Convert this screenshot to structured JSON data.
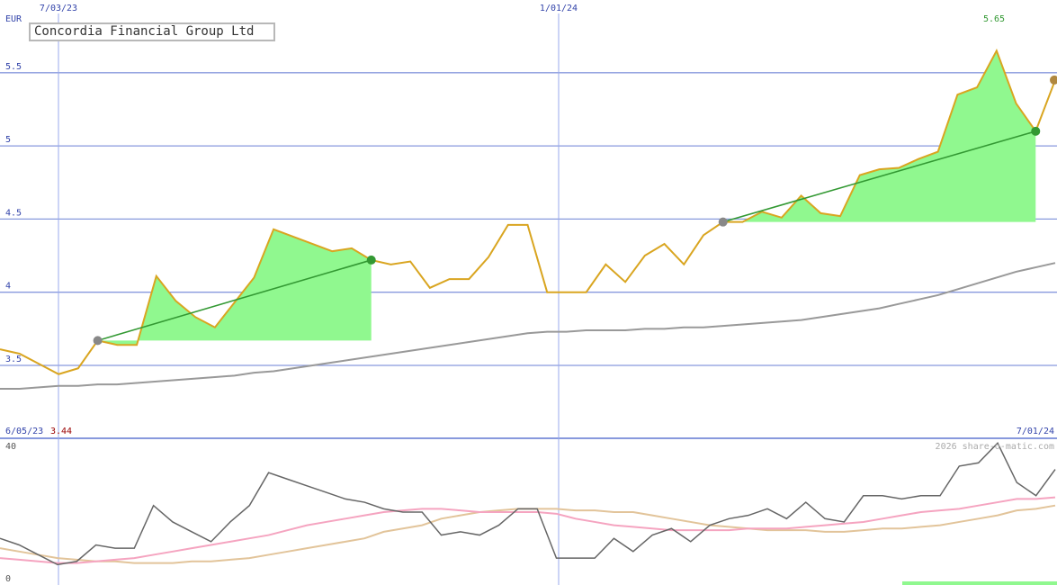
{
  "chart_data": [
    {
      "type": "line",
      "title": "Concordia Financial Group Ltd",
      "ylabel": "EUR",
      "ylim": [
        3.25,
        5.7
      ],
      "y_ticks": [
        "3.5",
        "4",
        "4.5",
        "5",
        "5.5"
      ],
      "x_tick_labels": [
        "7/03/23",
        "1/01/24"
      ],
      "start_date_label": "6/05/23",
      "end_date_label": "7/01/24",
      "low_label": "3.44",
      "high_label": "5.65",
      "grid": true,
      "series": [
        {
          "values": [
            3.61,
            3.58,
            3.51,
            3.44,
            3.48,
            3.67,
            3.64,
            3.64,
            4.11,
            3.94,
            3.83,
            3.76,
            3.93,
            4.1,
            4.43,
            4.38,
            4.33,
            4.28,
            4.3,
            4.22,
            4.19,
            4.21,
            4.03,
            4.09,
            4.09,
            4.24,
            4.46,
            4.46,
            4.0,
            4.0,
            4.0,
            4.19,
            4.07,
            4.25,
            4.33,
            4.19,
            4.39,
            4.48,
            4.48,
            4.55,
            4.51,
            4.66,
            4.54,
            4.52,
            4.8,
            4.84,
            4.85,
            4.91,
            4.96,
            5.35,
            5.4,
            5.65,
            5.29,
            5.1,
            5.45
          ]
        },
        {
          "values": [
            3.34,
            3.34,
            3.35,
            3.36,
            3.36,
            3.37,
            3.37,
            3.38,
            3.39,
            3.4,
            3.41,
            3.42,
            3.43,
            3.45,
            3.46,
            3.48,
            3.5,
            3.52,
            3.54,
            3.56,
            3.58,
            3.6,
            3.62,
            3.64,
            3.66,
            3.68,
            3.7,
            3.72,
            3.73,
            3.73,
            3.74,
            3.74,
            3.74,
            3.75,
            3.75,
            3.76,
            3.76,
            3.77,
            3.78,
            3.79,
            3.8,
            3.81,
            3.83,
            3.85,
            3.87,
            3.89,
            3.92,
            3.95,
            3.98,
            4.02,
            4.06,
            4.1,
            4.14,
            4.17,
            4.2
          ]
        }
      ],
      "trend_segments": [
        {
          "from_index": 5,
          "to_index": 19
        },
        {
          "from_index": 37,
          "to_index": 53
        }
      ]
    },
    {
      "type": "line",
      "ylim": [
        0,
        40
      ],
      "y_ticks": [
        "0",
        "40"
      ],
      "series": [
        {
          "values": [
            12,
            10,
            7,
            4,
            5,
            10,
            9,
            9,
            22,
            17,
            14,
            11,
            17,
            22,
            32,
            30,
            28,
            26,
            24,
            23,
            21,
            20,
            20,
            13,
            14,
            13,
            16,
            21,
            21,
            6,
            6,
            6,
            12,
            8,
            13,
            15,
            11,
            16,
            18,
            19,
            21,
            18,
            23,
            18,
            17,
            25,
            25,
            24,
            25,
            25,
            34,
            35,
            41,
            29,
            25,
            33
          ]
        },
        {
          "values": [
            6,
            5.5,
            5,
            4.5,
            4.5,
            5,
            5.5,
            6,
            7,
            8,
            9,
            10,
            11,
            12,
            13,
            14.5,
            16,
            17,
            18,
            19,
            20,
            20.5,
            21,
            21,
            20.5,
            20,
            20,
            20,
            20,
            19.5,
            18,
            17,
            16,
            15.5,
            15,
            14.5,
            14.5,
            14.5,
            14.5,
            15,
            15,
            15,
            15.5,
            16,
            16.5,
            17,
            18,
            19,
            20,
            20.5,
            21,
            22,
            23,
            24,
            24,
            24.5
          ]
        },
        {
          "values": [
            9,
            8,
            7,
            6,
            5.5,
            5,
            5,
            4.5,
            4.5,
            4.5,
            5,
            5,
            5.5,
            6,
            7,
            8,
            9,
            10,
            11,
            12,
            14,
            15,
            16,
            18,
            19,
            20,
            20.5,
            21,
            21,
            21,
            20.5,
            20.5,
            20,
            20,
            19,
            18,
            17,
            16,
            15.5,
            15,
            14.5,
            14.5,
            14.5,
            14,
            14,
            14.5,
            15,
            15,
            15.5,
            16,
            17,
            18,
            19,
            20.5,
            21,
            22
          ]
        }
      ]
    }
  ],
  "colors": {
    "price": "#d9a520",
    "moving_average": "#999999",
    "trend": "#339933",
    "fill": "#90f88f",
    "grid": "#8899dd",
    "axis_text": "#3344aa",
    "high": "#339933",
    "low": "#990000",
    "indicator_main": "#666666",
    "indicator_pink": "#f5a4c0",
    "indicator_tan": "#e2c49a"
  },
  "watermark": "2026 share-o-matic.com"
}
